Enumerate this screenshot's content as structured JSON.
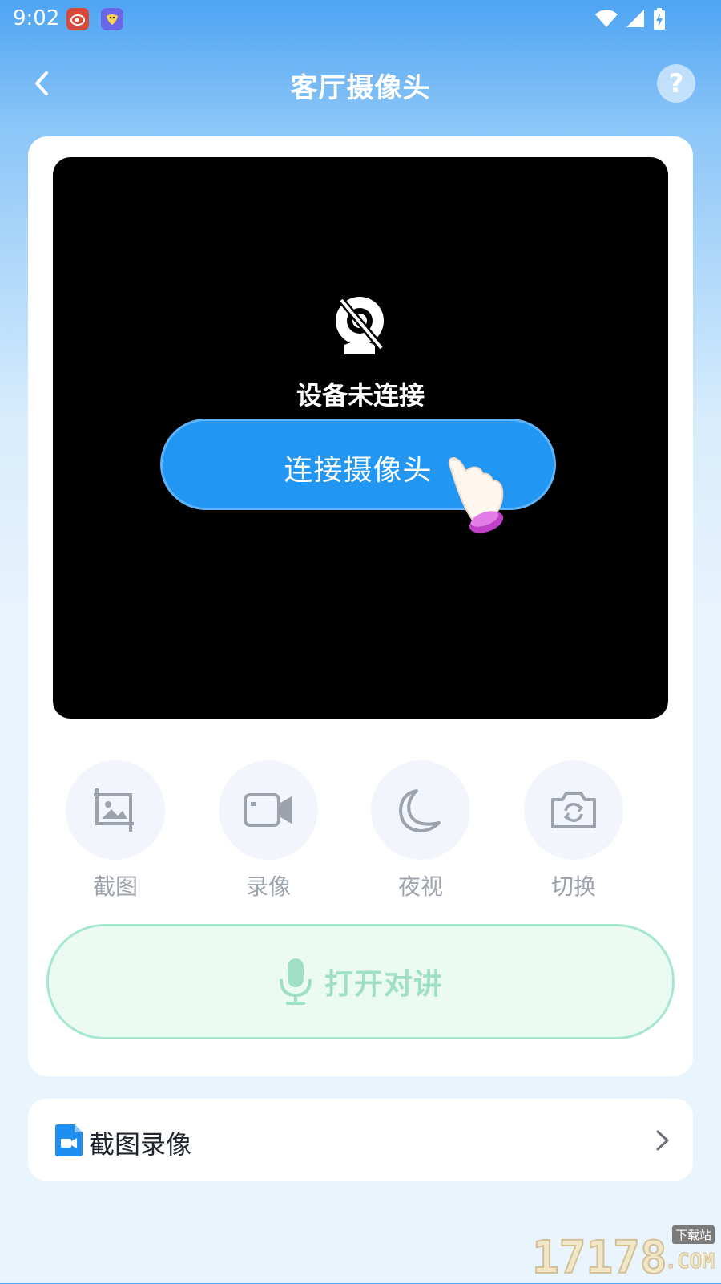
{
  "status_bar": {
    "time": "9:02",
    "icons": [
      "weibo-app-icon",
      "bird-app-icon",
      "wifi-icon",
      "signal-icon",
      "battery-charging-icon"
    ]
  },
  "header": {
    "title": "客厅摄像头",
    "help_label": "?"
  },
  "camera": {
    "status_text": "设备未连接",
    "connect_label": "连接摄像头"
  },
  "tools": [
    {
      "label": "截图",
      "icon": "screenshot-icon"
    },
    {
      "label": "录像",
      "icon": "video-camera-icon"
    },
    {
      "label": "夜视",
      "icon": "moon-icon"
    },
    {
      "label": "切换",
      "icon": "switch-camera-icon"
    }
  ],
  "talk": {
    "label": "打开对讲",
    "icon": "microphone-icon"
  },
  "media": {
    "label": "截图录像",
    "icon": "video-file-icon"
  },
  "watermark": {
    "digits": "17178",
    "tag": "下载站",
    "domain": ".COM"
  },
  "colors": {
    "accent": "#2196f3",
    "talk_green": "#9fe0c5",
    "tool_gray": "#9da3ad"
  }
}
